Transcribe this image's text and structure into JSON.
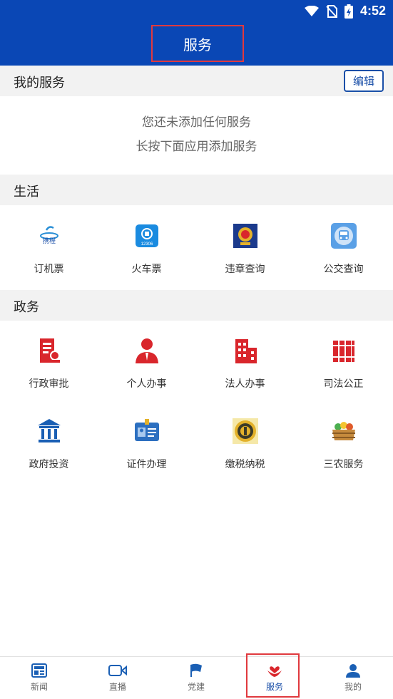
{
  "status_bar": {
    "time": "4:52"
  },
  "header": {
    "title": "服务"
  },
  "my_services": {
    "title": "我的服务",
    "edit_label": "编辑",
    "empty_line1": "您还未添加任何服务",
    "empty_line2": "长按下面应用添加服务"
  },
  "life": {
    "title": "生活",
    "items": [
      {
        "label": "订机票",
        "icon": "flight-ticket-icon"
      },
      {
        "label": "火车票",
        "icon": "train-ticket-icon"
      },
      {
        "label": "违章查询",
        "icon": "traffic-police-icon"
      },
      {
        "label": "公交查询",
        "icon": "bus-icon"
      }
    ]
  },
  "government": {
    "title": "政务",
    "items": [
      {
        "label": "行政审批",
        "icon": "approval-document-icon"
      },
      {
        "label": "个人办事",
        "icon": "person-icon"
      },
      {
        "label": "法人办事",
        "icon": "building-icon"
      },
      {
        "label": "司法公正",
        "icon": "law-books-icon"
      },
      {
        "label": "政府投资",
        "icon": "government-building-icon"
      },
      {
        "label": "证件办理",
        "icon": "id-card-icon"
      },
      {
        "label": "缴税纳税",
        "icon": "tax-emblem-icon"
      },
      {
        "label": "三农服务",
        "icon": "farm-produce-icon"
      }
    ]
  },
  "tabbar": {
    "items": [
      {
        "label": "新闻",
        "icon": "news-icon"
      },
      {
        "label": "直播",
        "icon": "video-icon"
      },
      {
        "label": "党建",
        "icon": "party-flag-icon"
      },
      {
        "label": "服务",
        "icon": "service-hands-icon",
        "active": true
      },
      {
        "label": "我的",
        "icon": "user-icon"
      }
    ]
  },
  "colors": {
    "primary": "#0a47b5",
    "accent_red": "#e0393e",
    "section_bg": "#f2f2f2",
    "gov_icon_red": "#d9262c"
  }
}
